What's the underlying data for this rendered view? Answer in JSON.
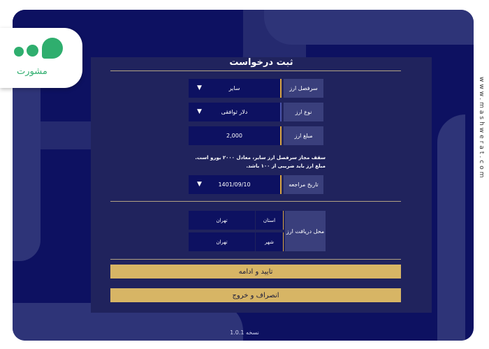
{
  "form": {
    "title": "ثبت درخواست",
    "fields": [
      {
        "label": "سرفصل ارز",
        "value": "سایر"
      },
      {
        "label": "نوع ارز",
        "value": "دلار ثوافقی"
      },
      {
        "label": "مبلغ ارز",
        "value": "2,000"
      },
      {
        "label": "تاریخ مراجعه",
        "value": "1401/09/10"
      }
    ],
    "note_line1": "سقف مجاز سرفصل ارز سایر، معادل ۲۰۰۰ یورو است.",
    "note_line2": "مبلغ ارز باید ضریبی از ۱۰۰ باشد.",
    "location": {
      "label": "محل دریافت ارز",
      "province_label": "استان",
      "province_value": "تهران",
      "city_label": "شهر",
      "city_value": "تهران"
    },
    "confirm_button": "تایید و ادامه",
    "cancel_button": "انصراف و خروج"
  },
  "version": "نسخه 1.0.1",
  "watermark": "www.mashwerat.com",
  "logo_text": "مشورت",
  "colors": {
    "background": "#0d1161",
    "panel": "#20235d",
    "label_cell": "#3a3f7c",
    "button": "#d7b565",
    "logo": "#2fae6e"
  }
}
